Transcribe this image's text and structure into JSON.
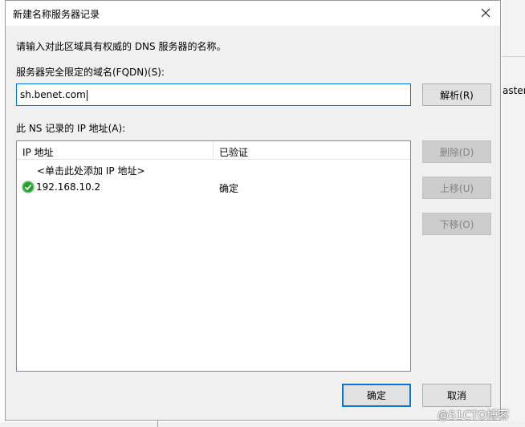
{
  "background": {
    "right_text": "aster",
    "watermark": "@51CTO博客"
  },
  "dialog": {
    "title": "新建名称服务器记录",
    "instruction": "请输入对此区域具有权威的 DNS 服务器的名称。",
    "fqdn_label": "服务器完全限定的域名(FQDN)(S):",
    "fqdn_value": "sh.benet.com",
    "resolve_button": "解析(R)",
    "ip_list_label": "此 NS 记录的 IP 地址(A):",
    "columns": {
      "ip": "IP 地址",
      "verified": "已验证"
    },
    "add_placeholder": "<单击此处添加 IP 地址>",
    "entries": [
      {
        "ip": "192.168.10.2",
        "status": "确定",
        "icon": "check-ok-icon"
      }
    ],
    "side_buttons": {
      "delete": "删除(D)",
      "move_up": "上移(U)",
      "move_down": "下移(O)"
    },
    "ok_button": "确定",
    "cancel_button": "取消"
  },
  "colors": {
    "accent": "#0078d7",
    "ok_green": "#21a12b"
  }
}
